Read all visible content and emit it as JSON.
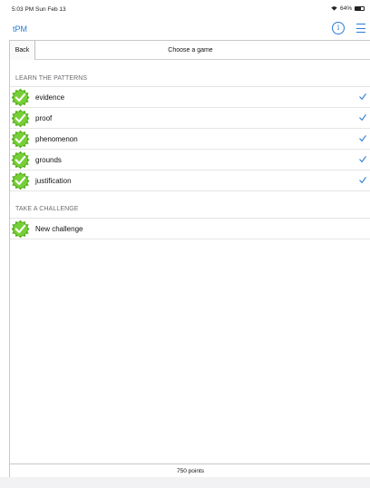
{
  "status_bar": {
    "time_date": "5:03 PM  Sun Feb 13",
    "battery": "64%"
  },
  "nav": {
    "app_title": "tPM",
    "info_glyph": "i",
    "icons": [
      "info-icon",
      "menu-icon"
    ]
  },
  "toolbar": {
    "back_label": "Back",
    "title": "Choose a game"
  },
  "sections": {
    "learn": {
      "header": "LEARN THE PATTERNS",
      "items": [
        {
          "label": "evidence",
          "checked": true
        },
        {
          "label": "proof",
          "checked": true
        },
        {
          "label": "phenomenon",
          "checked": true
        },
        {
          "label": "grounds",
          "checked": true
        },
        {
          "label": "justification",
          "checked": true
        }
      ]
    },
    "challenge": {
      "header": "TAKE A CHALLENGE",
      "items": [
        {
          "label": "New challenge",
          "checked": false
        }
      ]
    }
  },
  "footer": {
    "points": "750 points"
  },
  "colors": {
    "accent": "#2a7bd8",
    "badge_green": "#6cc52c",
    "badge_dark": "#4a9c18"
  }
}
